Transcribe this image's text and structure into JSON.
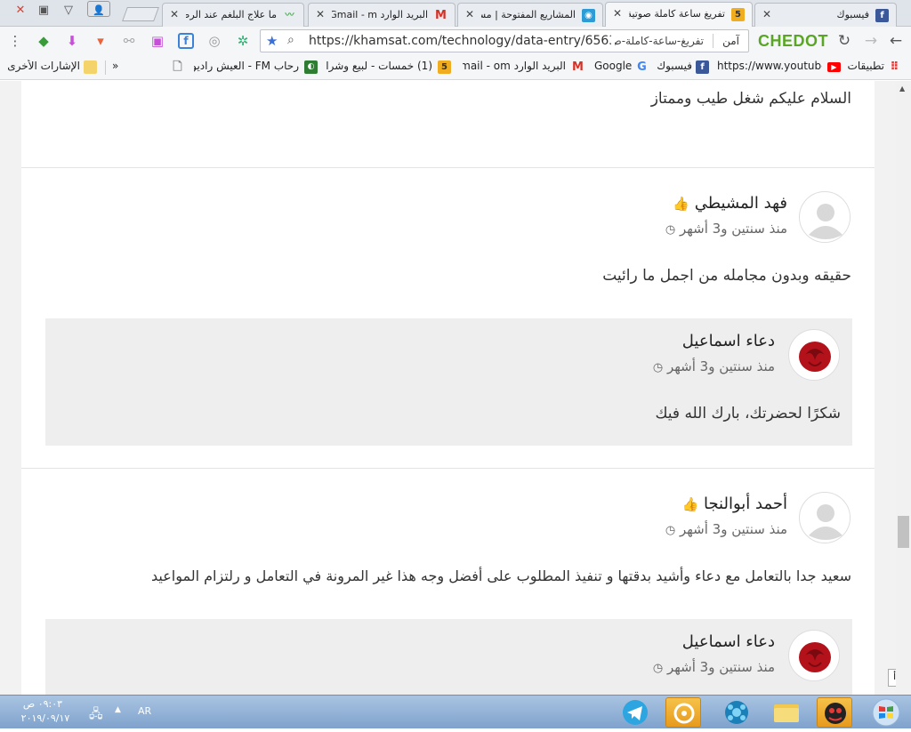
{
  "tabs": [
    {
      "title": "فيسبوك",
      "fav": "f",
      "fav_color": "#3b5998"
    },
    {
      "title": "تفريغ ساعة كاملة صوتية",
      "fav": "5",
      "fav_color": "#f0ad1f",
      "active": true
    },
    {
      "title": "المشاريع المفتوحة | مستقل",
      "fav": "◉",
      "fav_color": "#2c9bd6"
    },
    {
      "title": "البريد الوارد Gmail - m",
      "fav": "M",
      "fav_color": "#ffffff"
    },
    {
      "title": "ما علاج البلغم عند الرضع",
      "fav": "~",
      "fav_color": "#4caf50"
    }
  ],
  "toolbar": {
    "url": "https://khamsat.com/technology/data-entry/656397-...",
    "url_rtl": "تفريغ-ساعة-كاملة-ص",
    "secure": "آمن",
    "brand": "CHEDOT"
  },
  "bookmarks": [
    {
      "label": "تطبيقات",
      "icon": "apps-icon",
      "color": "#e53935"
    },
    {
      "label": "https://www.youtube",
      "icon": "youtube-icon",
      "color": "#ff0000"
    },
    {
      "label": "فيسبوك",
      "icon": "facebook-icon",
      "color": "#3b5998"
    },
    {
      "label": "Google",
      "icon": "google-icon",
      "color": "#4285f4"
    },
    {
      "label": "البريد الوارد Gmail - om",
      "icon": "gmail-icon",
      "color": "#d93025"
    },
    {
      "label": "(1) خمسات - لبيع وشراء ال",
      "icon": "khamsat-icon",
      "color": "#f0ad1f"
    },
    {
      "label": "رحاب FM - العيش راديو ا",
      "icon": "radio-icon",
      "color": "#2e7d32"
    },
    {
      "label": "»",
      "icon": "",
      "color": ""
    },
    {
      "label": "الإشارات الأخرى",
      "icon": "folder-icon",
      "color": "#f5d36b"
    }
  ],
  "comments": {
    "top_text": "السلام عليكم شغل طيب وممتاز",
    "c1": {
      "name": "فهد المشيطي",
      "time": "منذ سنتين و3 أشهر",
      "text": "حقيقه وبدون مجامله من اجمل ما رائيت",
      "reply": {
        "name": "دعاء اسماعيل",
        "time": "منذ سنتين و3 أشهر",
        "text": "شكرًا لحضرتك، بارك الله فيك"
      }
    },
    "c2": {
      "name": "أحمد أبوالنجا",
      "time": "منذ سنتين و3 أشهر",
      "text": "سعيد جدا بالتعامل مع دعاء وأشيد بدقتها و تنفيذ المطلوب على أفضل وجه هذا غير المرونة في التعامل و رلتزام المواعيد",
      "reply": {
        "name": "دعاء اسماعيل",
        "time": "منذ سنتين و3 أشهر"
      }
    }
  },
  "side_button": "ابدأ",
  "taskbar": {
    "time": "٠٩:٠٣ ص",
    "date": "٢٠١٩/٠٩/١٧",
    "lang": "AR"
  }
}
